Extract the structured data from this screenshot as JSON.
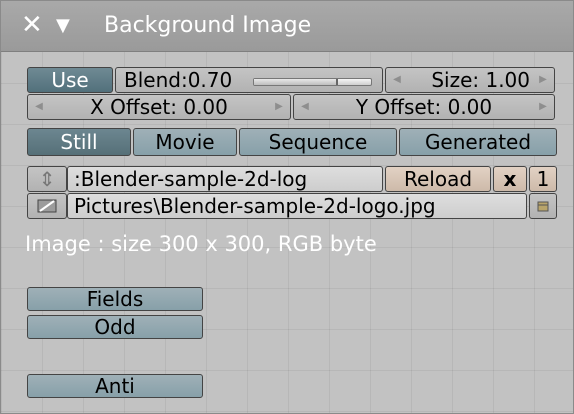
{
  "header": {
    "close_glyph": "✕",
    "collapse_glyph": "▼",
    "title": "Background Image"
  },
  "controls": {
    "use_label": "Use",
    "blend_label": "Blend:0.70",
    "blend_value": 0.7,
    "size_label": "Size: 1.00",
    "x_offset_label": "X Offset: 0.00",
    "y_offset_label": "Y Offset: 0.00"
  },
  "source_tabs": {
    "items": [
      "Still",
      "Movie",
      "Sequence",
      "Generated"
    ],
    "active": "Still"
  },
  "image": {
    "browse_glyph": "⇕",
    "name_value": ":Blender-sample-2d-log",
    "reload_label": "Reload",
    "unlink_glyph": "x",
    "users_count": "1",
    "path_value": "Pictures\\Blender-sample-2d-logo.jpg"
  },
  "status": {
    "info": "Image : size 300 x 300, RGB byte"
  },
  "options": {
    "fields_label": "Fields",
    "odd_label": "Odd",
    "anti_label": "Anti"
  },
  "colors": {
    "panel_bg": "#c2c2c2",
    "header_bg": "#a3a3a3",
    "active_toggle": "#5f7b85",
    "reload_bg": "#d8c6b7",
    "text_white": "#ffffff"
  }
}
